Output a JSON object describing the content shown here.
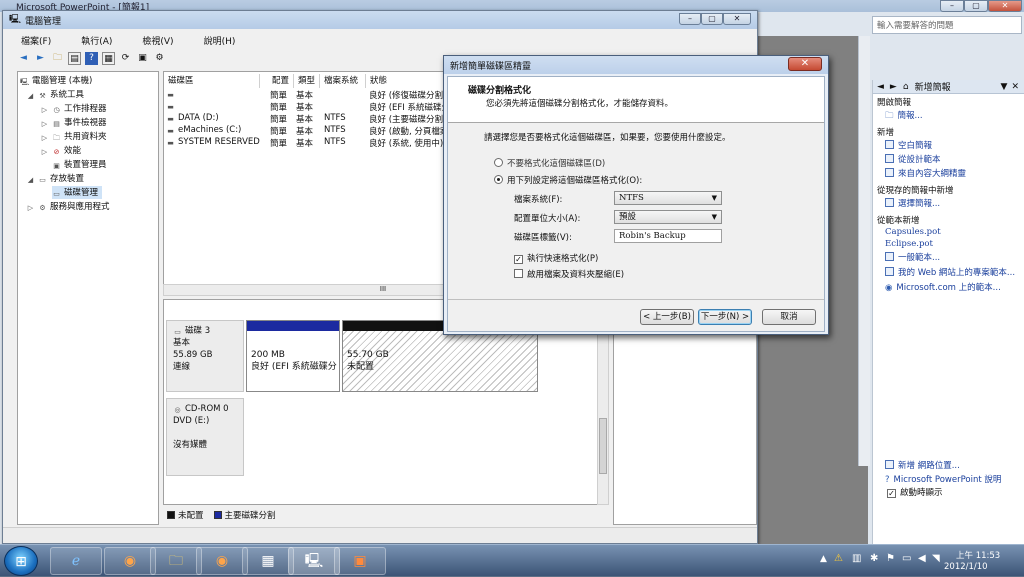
{
  "ppt": {
    "title": "Microsoft PowerPoint - [簡報1]",
    "help_placeholder": "輸入需要解答的問題",
    "pane": {
      "title": "新增簡報",
      "open_section": "開啟簡報",
      "open_link": "簡報...",
      "new_section": "新增",
      "new_items": [
        "空白簡報",
        "從設計範本",
        "來自內容大綱精靈"
      ],
      "existing_section": "從現存的簡報中新增",
      "existing_link": "選擇簡報...",
      "template_section": "從範本新增",
      "templates": [
        "Capsules.pot",
        "Eclipse.pot"
      ],
      "template_links": [
        "一般範本...",
        "我的 Web 網站上的專案範本...",
        "Microsoft.com 上的範本..."
      ],
      "footer_links": [
        "新增 網路位置...",
        "Microsoft PowerPoint 說明"
      ],
      "startup_label": "啟動時顯示"
    }
  },
  "cm": {
    "title": "電腦管理",
    "menu": [
      "檔案(F)",
      "執行(A)",
      "檢視(V)",
      "說明(H)"
    ],
    "tree": [
      {
        "label": "電腦管理 (本機)",
        "depth": 0
      },
      {
        "label": "系統工具",
        "depth": 1
      },
      {
        "label": "工作排程器",
        "depth": 2
      },
      {
        "label": "事件檢視器",
        "depth": 2
      },
      {
        "label": "共用資料夾",
        "depth": 2
      },
      {
        "label": "效能",
        "depth": 2
      },
      {
        "label": "裝置管理員",
        "depth": 2
      },
      {
        "label": "存放裝置",
        "depth": 1
      },
      {
        "label": "磁碟管理",
        "depth": 2
      },
      {
        "label": "服務與應用程式",
        "depth": 1
      }
    ],
    "columns": [
      "磁碟區",
      "配置",
      "類型",
      "檔案系統",
      "狀態"
    ],
    "volumes": [
      {
        "name": "",
        "layout": "簡單",
        "type": "基本",
        "fs": "",
        "status": "良好 (修復磁碟分割)"
      },
      {
        "name": "",
        "layout": "簡單",
        "type": "基本",
        "fs": "",
        "status": "良好 (EFI 系統磁碟分割)"
      },
      {
        "name": "DATA (D:)",
        "layout": "簡單",
        "type": "基本",
        "fs": "NTFS",
        "status": "良好 (主要磁碟分割)"
      },
      {
        "name": "eMachines (C:)",
        "layout": "簡單",
        "type": "基本",
        "fs": "NTFS",
        "status": "良好 (啟動, 分頁檔案)"
      },
      {
        "name": "SYSTEM RESERVED",
        "layout": "簡單",
        "type": "基本",
        "fs": "NTFS",
        "status": "良好 (系統, 使用中)"
      }
    ],
    "hscroll_label": "III",
    "disk3": {
      "name": "磁碟 3",
      "type": "基本",
      "size": "55.89 GB",
      "state": "連線"
    },
    "disk3_parts": [
      {
        "size": "200 MB",
        "status": "良好 (EFI 系統磁碟分"
      },
      {
        "size": "55.70 GB",
        "status": "未配置"
      }
    ],
    "cdrom": {
      "name": "CD-ROM 0",
      "drive": "DVD (E:)",
      "media": "沒有媒體"
    },
    "legend": [
      "未配置",
      "主要磁碟分割"
    ]
  },
  "wizard": {
    "title": "新增簡單磁碟區精靈",
    "heading": "磁碟分割格式化",
    "subheading": "您必須先將這個磁碟分割格式化，才能儲存資料。",
    "prompt": "請選擇您是否要格式化這個磁碟區，如果要，您要使用什麼設定。",
    "radio_no_format": "不要格式化這個磁碟區(D)",
    "radio_format": "用下列設定將這個磁碟區格式化(O):",
    "fs_label": "檔案系統(F):",
    "fs_value": "NTFS",
    "alloc_label": "配置單位大小(A):",
    "alloc_value": "預設",
    "vol_label": "磁碟區標籤(V):",
    "vol_value": "Robin's Backup",
    "quick_format": "執行快速格式化(P)",
    "compression": "啟用檔案及資料夾壓縮(E)",
    "back_btn": "< 上一步(B)",
    "next_btn": "下一步(N) >",
    "cancel_btn": "取消"
  },
  "taskbar": {
    "time": "上午 11:53",
    "date": "2012/1/10"
  },
  "colors": {
    "unallocated": "#111111",
    "primary_partition": "#1c2aa0"
  }
}
